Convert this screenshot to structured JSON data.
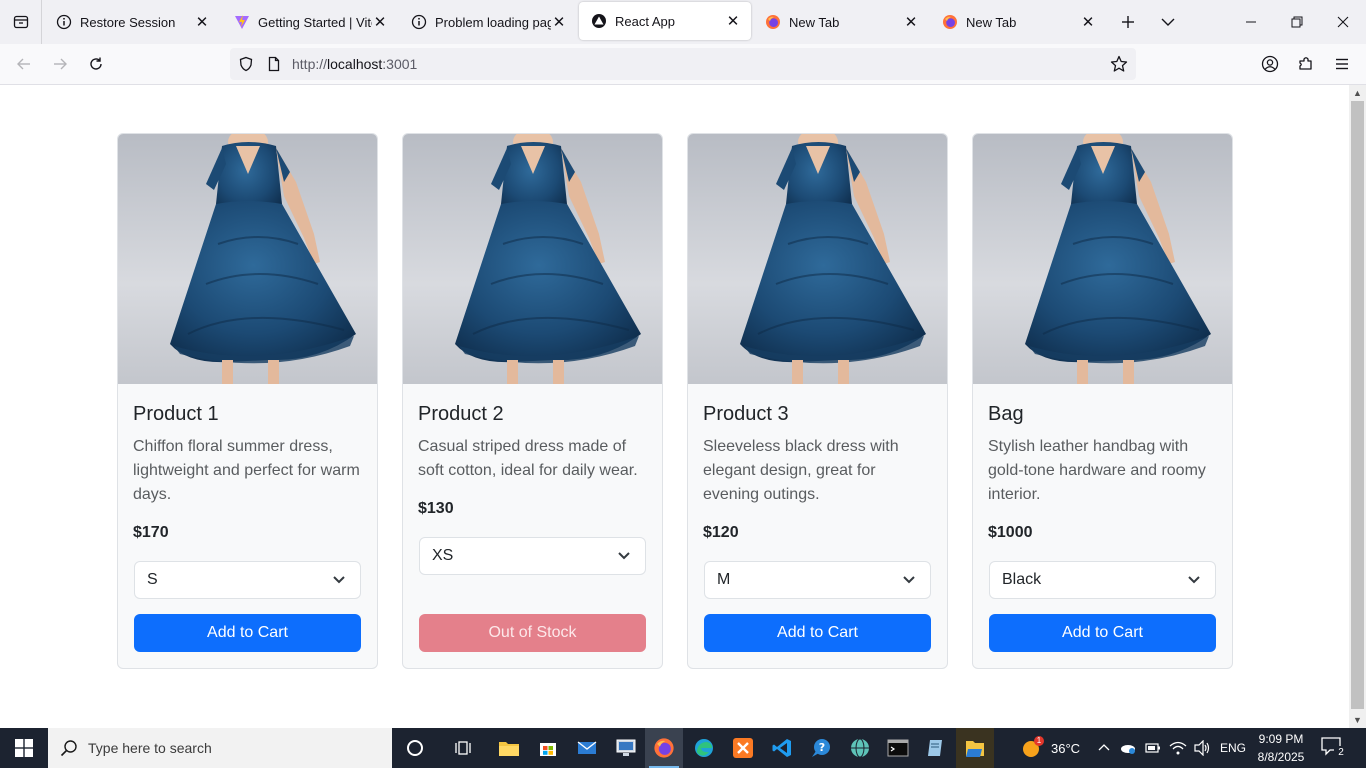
{
  "browser": {
    "tabs": [
      {
        "title": "Restore Session",
        "icon": "info-icon"
      },
      {
        "title": "Getting Started | Vite",
        "icon": "vite-icon"
      },
      {
        "title": "Problem loading page",
        "icon": "info-icon"
      },
      {
        "title": "React App",
        "icon": "react-icon",
        "active": true
      },
      {
        "title": "New Tab",
        "icon": "firefox-icon"
      },
      {
        "title": "New Tab",
        "icon": "firefox-icon"
      }
    ],
    "url_prefix": "http://",
    "url_host": "localhost",
    "url_suffix": ":3001"
  },
  "products": [
    {
      "name": "Product 1",
      "description": "Chiffon floral summer dress, lightweight and perfect for warm days.",
      "price": "$170",
      "selected_option": "S",
      "button_label": "Add to Cart",
      "in_stock": true
    },
    {
      "name": "Product 2",
      "description": "Casual striped dress made of soft cotton, ideal for daily wear.",
      "price": "$130",
      "selected_option": "XS",
      "button_label": "Out of Stock",
      "in_stock": false
    },
    {
      "name": "Product 3",
      "description": "Sleeveless black dress with elegant design, great for evening outings.",
      "price": "$120",
      "selected_option": "M",
      "button_label": "Add to Cart",
      "in_stock": true
    },
    {
      "name": "Bag",
      "description": "Stylish leather handbag with gold-tone hardware and roomy interior.",
      "price": "$1000",
      "selected_option": "Black",
      "button_label": "Add to Cart",
      "in_stock": true
    }
  ],
  "taskbar": {
    "search_placeholder": "Type here to search",
    "weather": "36°C",
    "weather_badge": "1",
    "language": "ENG",
    "time": "9:09 PM",
    "date": "8/8/2025",
    "notification_count": "2"
  },
  "colors": {
    "primary_button": "#0d6efd",
    "disabled_button": "#e4808b",
    "taskbar": "#1c2330"
  }
}
